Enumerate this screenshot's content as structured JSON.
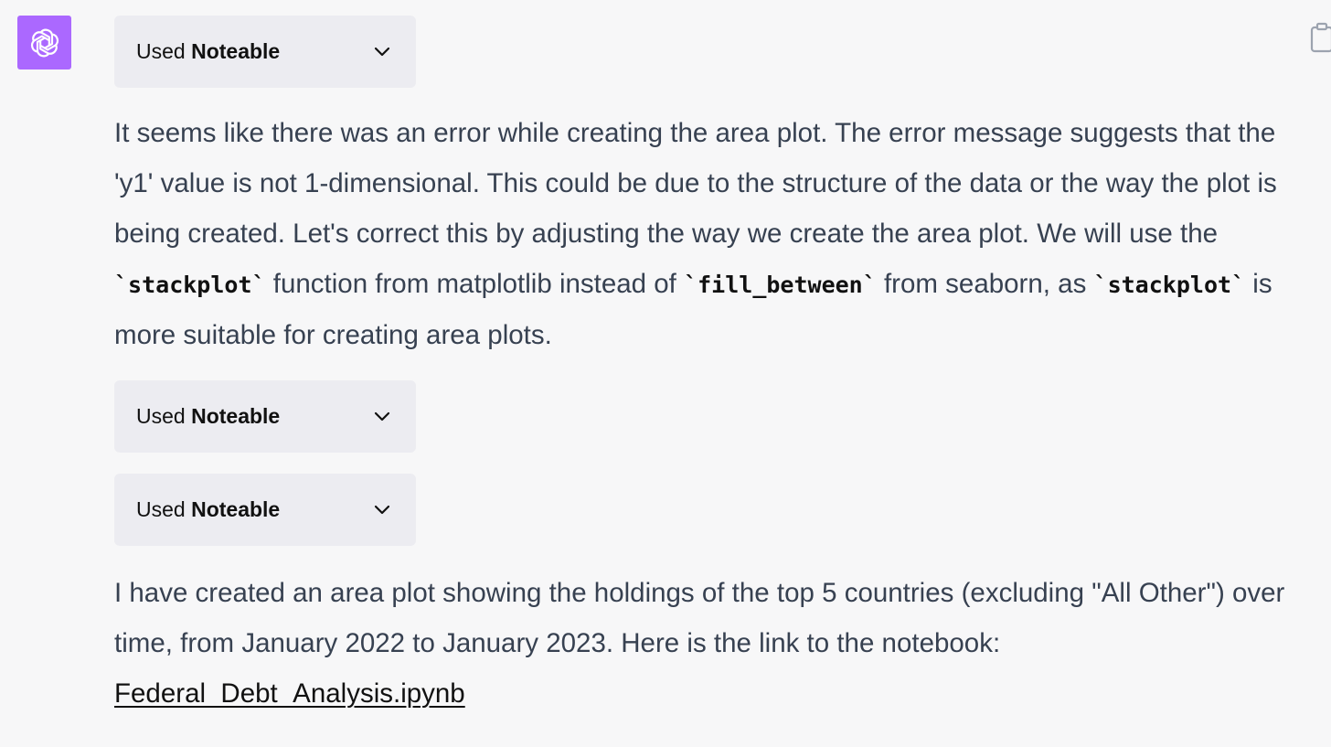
{
  "assistant": {
    "avatar_icon": "openai-logo-icon",
    "avatar_color": "#ab68ff"
  },
  "toolbar": {
    "copy_icon": "clipboard-icon"
  },
  "tool_calls": [
    {
      "prefix": "Used",
      "name": "Noteable",
      "icon": "chevron-down-icon"
    },
    {
      "prefix": "Used",
      "name": "Noteable",
      "icon": "chevron-down-icon"
    },
    {
      "prefix": "Used",
      "name": "Noteable",
      "icon": "chevron-down-icon"
    }
  ],
  "message1": {
    "text_a": "It seems like there was an error while creating the area plot. The error message suggests that the 'y1' value is not 1-dimensional. This could be due to the structure of the data or the way the plot is being created. Let's correct this by adjusting the way we create the area plot. We will use the ",
    "code_a": "`stackplot`",
    "text_b": " function from matplotlib instead of ",
    "code_b": "`fill_between`",
    "text_c": " from seaborn, as ",
    "code_c": "`stackplot`",
    "text_d": " is more suitable for creating area plots."
  },
  "message2": {
    "text": "I have created an area plot showing the holdings of the top 5 countries (excluding \"All Other\") over time, from January 2022 to January 2023. Here is the link to the notebook:",
    "link_label": "Federal_Debt_Analysis.ipynb"
  }
}
